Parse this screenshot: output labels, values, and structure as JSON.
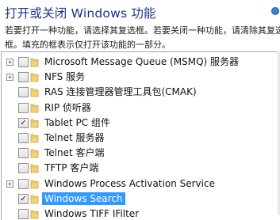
{
  "title": "打开或关闭 Windows 功能",
  "description": [
    "若要打开一种功能，请选择其复选框。若要关闭一种功能，请清除其复选",
    "框。填充的框表示仅打开该功能的一部分。"
  ],
  "features": [
    {
      "label": "Microsoft Message Queue (MSMQ) 服务器",
      "expander": "+",
      "checked": false,
      "selected": false
    },
    {
      "label": "NFS 服务",
      "expander": "+",
      "checked": false,
      "selected": false
    },
    {
      "label": "RAS 连接管理器管理工具包(CMAK)",
      "expander": "",
      "checked": false,
      "selected": false
    },
    {
      "label": "RIP 侦听器",
      "expander": "",
      "checked": false,
      "selected": false
    },
    {
      "label": "Tablet PC 组件",
      "expander": "",
      "checked": true,
      "selected": false
    },
    {
      "label": "Telnet 服务器",
      "expander": "",
      "checked": false,
      "selected": false
    },
    {
      "label": "Telnet 客户端",
      "expander": "",
      "checked": false,
      "selected": false
    },
    {
      "label": "TFTP 客户端",
      "expander": "",
      "checked": false,
      "selected": false
    },
    {
      "label": "Windows Process Activation Service",
      "expander": "+",
      "checked": false,
      "selected": false
    },
    {
      "label": "Windows Search",
      "expander": "",
      "checked": true,
      "selected": true
    },
    {
      "label": "Windows TIFF IFilter",
      "expander": "",
      "checked": false,
      "selected": false
    }
  ]
}
